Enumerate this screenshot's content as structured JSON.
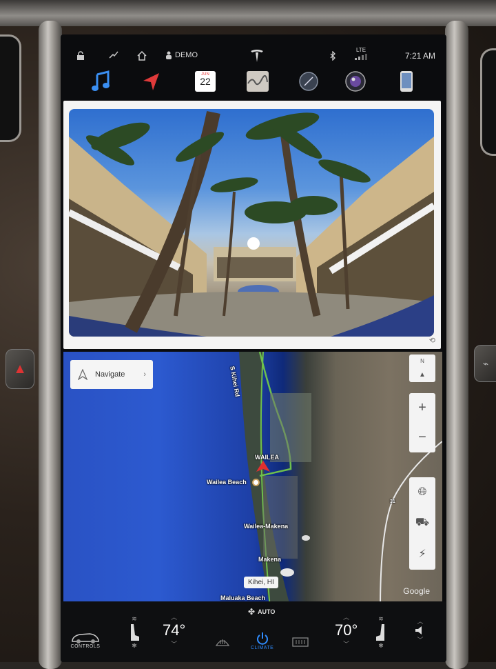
{
  "status_bar": {
    "profile_label": "DEMO",
    "network_label": "LTE",
    "time": "7:21 AM"
  },
  "app_bar": {
    "calendar_month": "JUN",
    "calendar_day": "22",
    "apps": [
      "music-icon",
      "navigation-icon",
      "calendar-icon",
      "energy-icon",
      "web-icon",
      "camera-icon",
      "phone-icon"
    ]
  },
  "map": {
    "navigate_label": "Navigate",
    "zoom_in": "+",
    "zoom_out": "−",
    "compass": "N",
    "labels": {
      "wailea": "WAILEA",
      "wailea_beach": "Wailea Beach",
      "wailea_makena": "Wailea-Makena",
      "makena": "Makena",
      "maluaka_beach": "Maluaka Beach",
      "kihei_rd": "S Kihei Rd",
      "route_31": "31"
    },
    "location_bubble": "Kihei, HI",
    "attribution": "Google"
  },
  "climate": {
    "controls_label": "CONTROLS",
    "driver_temp": "74°",
    "climate_label": "CLIMATE",
    "passenger_temp": "70°",
    "auto_label": "AUTO"
  }
}
